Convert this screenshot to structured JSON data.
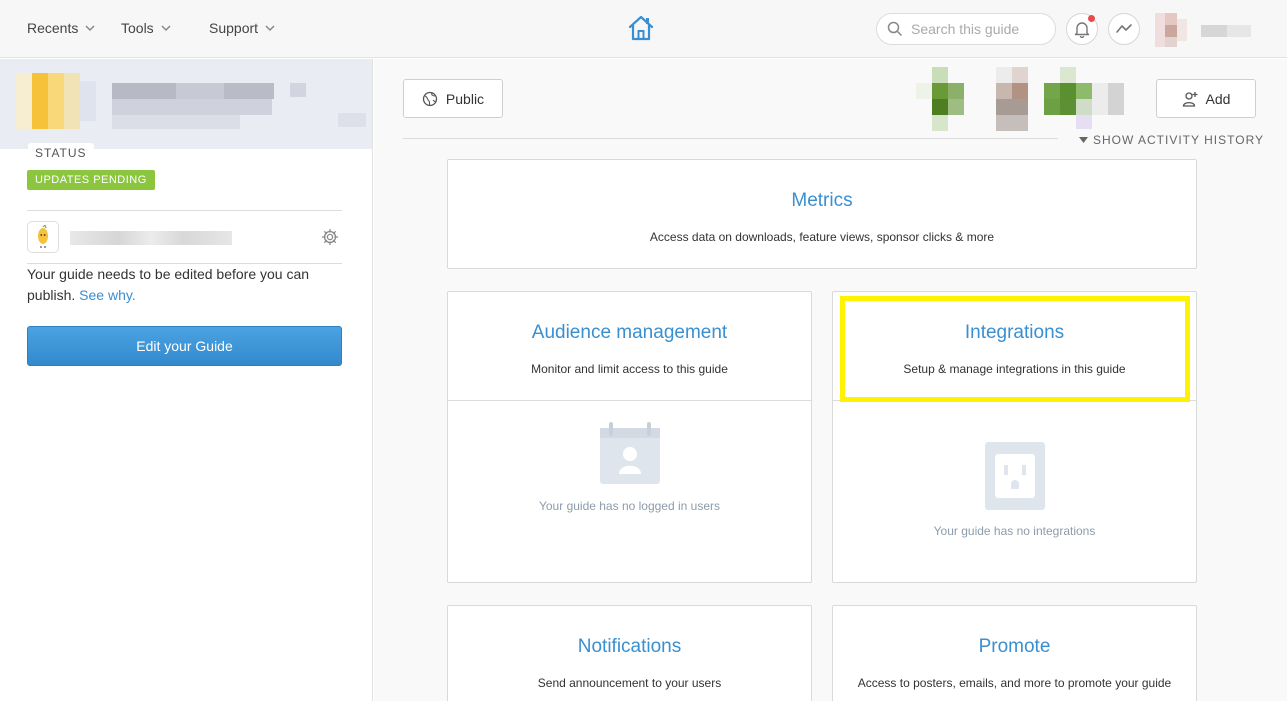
{
  "nav": {
    "recents": "Recents",
    "tools": "Tools",
    "support": "Support"
  },
  "search": {
    "placeholder": "Search this guide"
  },
  "sidebar": {
    "status_label": "STATUS",
    "status_badge": "UPDATES PENDING",
    "message": "Your guide needs to be edited before you can publish.",
    "see_why": "See why.",
    "edit_button": "Edit your Guide"
  },
  "toolbar": {
    "public_label": "Public",
    "add_label": "Add",
    "activity_label": "SHOW ACTIVITY HISTORY"
  },
  "cards": {
    "metrics": {
      "title": "Metrics",
      "desc": "Access data on downloads, feature views, sponsor clicks & more"
    },
    "audience": {
      "title": "Audience management",
      "desc": "Monitor and limit access to this guide",
      "empty": "Your guide has no logged in users"
    },
    "integrations": {
      "title": "Integrations",
      "desc": "Setup & manage integrations in this guide",
      "empty": "Your guide has no integrations"
    },
    "notifications": {
      "title": "Notifications",
      "desc": "Send announcement to your users"
    },
    "promote": {
      "title": "Promote",
      "desc": "Access to posters, emails, and more to promote your guide"
    }
  },
  "colors": {
    "accent": "#3a8fd0",
    "badge": "#8cc63f",
    "highlight": "#fff200",
    "notification_dot": "#e74c4c"
  },
  "icons": [
    "chevron-down-icon",
    "home-icon",
    "search-icon",
    "bell-icon",
    "activity-icon",
    "gear-icon",
    "globe-icon",
    "add-user-icon",
    "calendar-user-icon",
    "power-outlet-icon",
    "caret-down-icon"
  ]
}
